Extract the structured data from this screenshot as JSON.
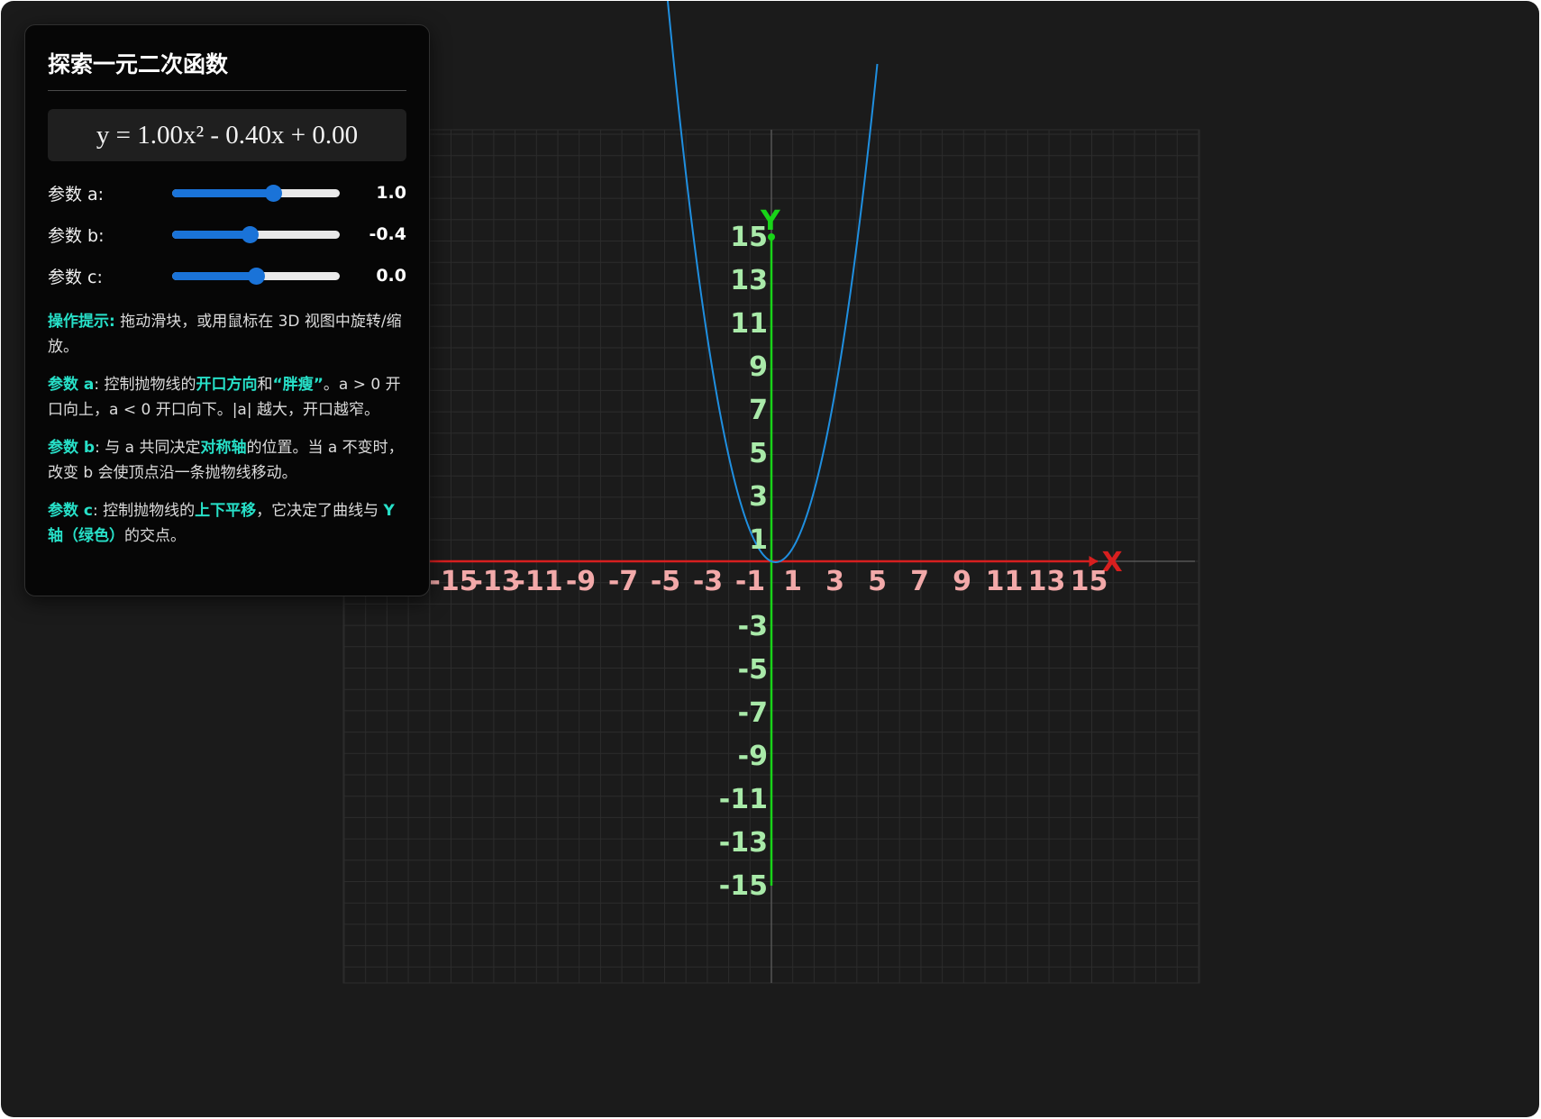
{
  "panel": {
    "title": "探索一元二次函数",
    "equation": "y = 1.00x² - 0.40x + 0.00",
    "params": [
      {
        "label": "参数 a:",
        "value": "1.0",
        "min": -5,
        "max": 5,
        "current": 1.0
      },
      {
        "label": "参数 b:",
        "value": "-0.4",
        "min": -5,
        "max": 5,
        "current": -0.4
      },
      {
        "label": "参数 c:",
        "value": "0.0",
        "min": -10,
        "max": 10,
        "current": 0.0
      }
    ],
    "notes": {
      "hint_key": "操作提示:",
      "hint_text": " 拖动滑块，或用鼠标在 3D 视图中旋转/缩放。",
      "a_key": "参数 a",
      "a_t1": ": 控制抛物线的",
      "a_hl1": "开口方向",
      "a_t2": "和",
      "a_hl2": "“胖瘦”",
      "a_t3": "。a > 0 开口向上，a < 0 开口向下。|a| 越大，开口越窄。",
      "b_key": "参数 b",
      "b_t1": ": 与 a 共同决定",
      "b_hl1": "对称轴",
      "b_t2": "的位置。当 a 不变时，改变 b 会使顶点沿一条抛物线移动。",
      "c_key": "参数 c",
      "c_t1": ": 控制抛物线的",
      "c_hl1": "上下平移",
      "c_t2": "，它决定了曲线与 ",
      "c_hl2": "Y 轴（绿色）",
      "c_t3": "的交点。"
    }
  },
  "chart_data": {
    "type": "line",
    "function": "y = 1.00x^2 - 0.40x + 0.00",
    "coefficients": {
      "a": 1.0,
      "b": -0.4,
      "c": 0.0
    },
    "x_axis": {
      "label": "X",
      "ticks": [
        -15,
        -13,
        -11,
        -9,
        -7,
        -5,
        -3,
        -1,
        1,
        3,
        5,
        7,
        9,
        11,
        13,
        15
      ],
      "range": [
        -15,
        15
      ]
    },
    "y_axis": {
      "label": "Y",
      "ticks": [
        15,
        13,
        11,
        9,
        7,
        5,
        3,
        1,
        -3,
        -5,
        -7,
        -9,
        -11,
        -13,
        -15
      ],
      "range": [
        -15,
        15
      ]
    },
    "grid": true,
    "colors": {
      "curve": "#1f8fe0",
      "x_axis": "#d71f1f",
      "y_axis": "#18d418",
      "x_ticks": "#f2a9a9",
      "y_ticks": "#a9eaa9",
      "grid": "#2c2c2c"
    }
  }
}
